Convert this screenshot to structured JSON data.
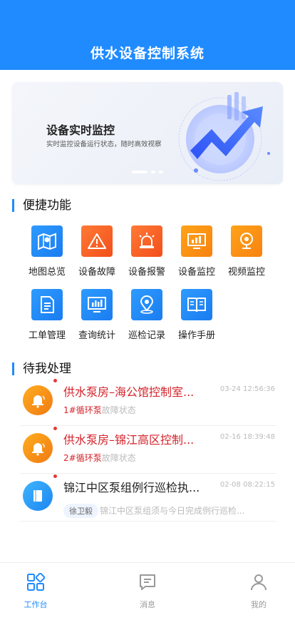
{
  "header": {
    "title": "供水设备控制系统"
  },
  "banner": {
    "title": "设备实时监控",
    "subtitle": "实时监控设备运行状态，随时高效视察",
    "page_count": 3,
    "active_page": 1
  },
  "quick_functions": {
    "title": "便捷功能",
    "items": [
      {
        "label": "地图总览",
        "icon": "map-icon",
        "color": "#1f8bff"
      },
      {
        "label": "设备故障",
        "icon": "warning-icon",
        "color": "#f4581f"
      },
      {
        "label": "设备报警",
        "icon": "alarm-light-icon",
        "color": "#f4581f"
      },
      {
        "label": "设备监控",
        "icon": "monitor-chart-icon",
        "color": "#f8901a"
      },
      {
        "label": "视频监控",
        "icon": "camera-icon",
        "color": "#f8901a"
      },
      {
        "label": "工单管理",
        "icon": "document-icon",
        "color": "#1f8bff"
      },
      {
        "label": "查询统计",
        "icon": "statistics-icon",
        "color": "#1f8bff"
      },
      {
        "label": "巡检记录",
        "icon": "location-pin-icon",
        "color": "#1f8bff"
      },
      {
        "label": "操作手册",
        "icon": "manual-book-icon",
        "color": "#1f8bff"
      }
    ]
  },
  "pending": {
    "title": "待我处理",
    "items": [
      {
        "title": "供水泵房–海公馆控制室...",
        "time": "03-24 12:56:36",
        "sub_strong": "1#循环泵",
        "sub_text": "故障状态",
        "icon": "bell-icon",
        "type": "alarm"
      },
      {
        "title": "供水泵房–锦江高区控制...",
        "time": "02-16 18:39:48",
        "sub_strong": "2#循环泵",
        "sub_text": "故障状态",
        "icon": "bell-icon",
        "type": "alarm"
      },
      {
        "title": "锦江中区泵组例行巡检执...",
        "time": "02-08 08:22:15",
        "tag": "徐卫毅",
        "sub_text": "锦江中区泵组须与今日完成例行巡检...",
        "icon": "book-icon",
        "type": "task"
      }
    ]
  },
  "tabbar": {
    "items": [
      {
        "label": "工作台",
        "icon": "workbench-icon",
        "active": true
      },
      {
        "label": "消息",
        "icon": "message-icon",
        "active": false
      },
      {
        "label": "我的",
        "icon": "user-icon",
        "active": false
      }
    ]
  },
  "colors": {
    "primary": "#1f8bff",
    "alert_red": "#d4232b",
    "muted": "#bbbbbb"
  }
}
